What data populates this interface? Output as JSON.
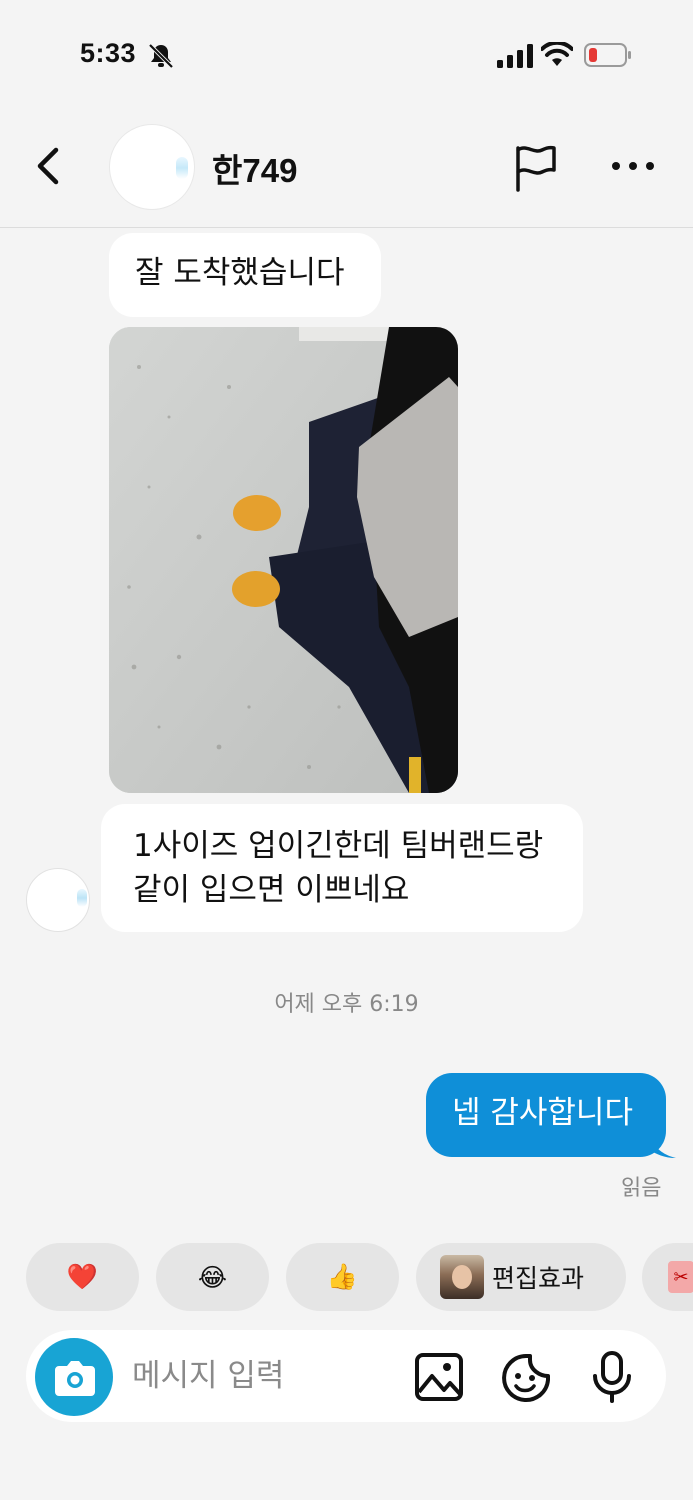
{
  "status_bar": {
    "time": "5:33",
    "battery_color": "#e53935"
  },
  "header": {
    "name": "한749"
  },
  "messages": [
    {
      "direction": "in",
      "text": "잘 도착했습니다"
    },
    {
      "direction": "in",
      "type": "photo"
    },
    {
      "direction": "in",
      "text": "1사이즈 업이긴한데 팀버랜드랑 같이 입으면 이쁘네요"
    },
    {
      "direction": "out",
      "text": "넵 감사합니다"
    }
  ],
  "timestamp": "어제 오후 6:19",
  "read_receipt": "읽음",
  "quick_replies": {
    "heart": "❤️",
    "laugh": "😂",
    "thumbs_up": "👍",
    "effect_label": "편집효과"
  },
  "composer": {
    "placeholder": "메시지 입력"
  },
  "colors": {
    "accent": "#0f8fd8",
    "camera": "#18a4d4",
    "background": "#f4f4f4"
  },
  "icons": [
    "bell-off-icon",
    "signal-icon",
    "wifi-icon",
    "battery-icon",
    "back-icon",
    "flag-icon",
    "more-icon",
    "camera-icon",
    "gallery-icon",
    "sticker-icon",
    "mic-icon"
  ]
}
